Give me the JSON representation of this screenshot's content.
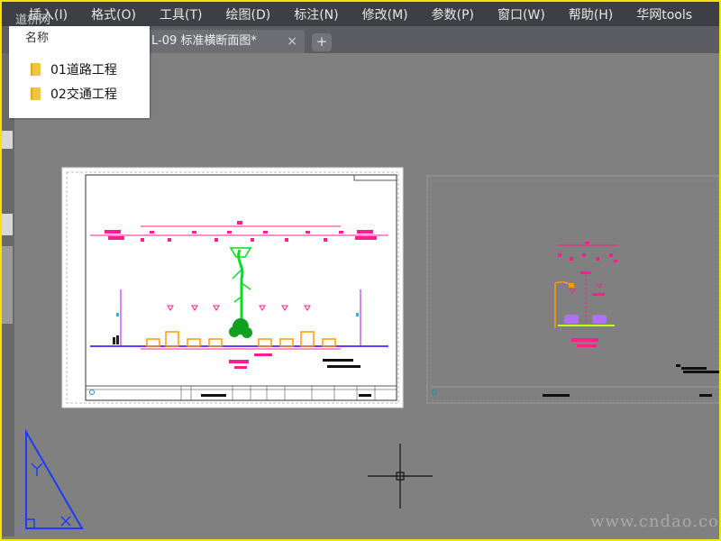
{
  "menu": [
    "插入(I)",
    "格式(O)",
    "工具(T)",
    "绘图(D)",
    "标注(N)",
    "修改(M)",
    "参数(P)",
    "窗口(W)",
    "帮助(H)",
    "华网tools"
  ],
  "tab": {
    "label": "L-09 标准横断面图*",
    "close_label": "×",
    "add_label": "+"
  },
  "panel": {
    "ghost_text": "道桥网",
    "header": "名称",
    "items": [
      {
        "label": "01道路工程",
        "icon": "folder-icon"
      },
      {
        "label": "02交通工程",
        "icon": "folder-icon"
      }
    ]
  },
  "watermark": "www.cndao.com",
  "colors": {
    "frame": "#f2e600",
    "menubar": "#3d3f45",
    "canvas": "#808080",
    "magenta": "#ff1f8e",
    "green": "#00e020",
    "orange": "#ff9a00",
    "purple": "#6a3cff"
  }
}
